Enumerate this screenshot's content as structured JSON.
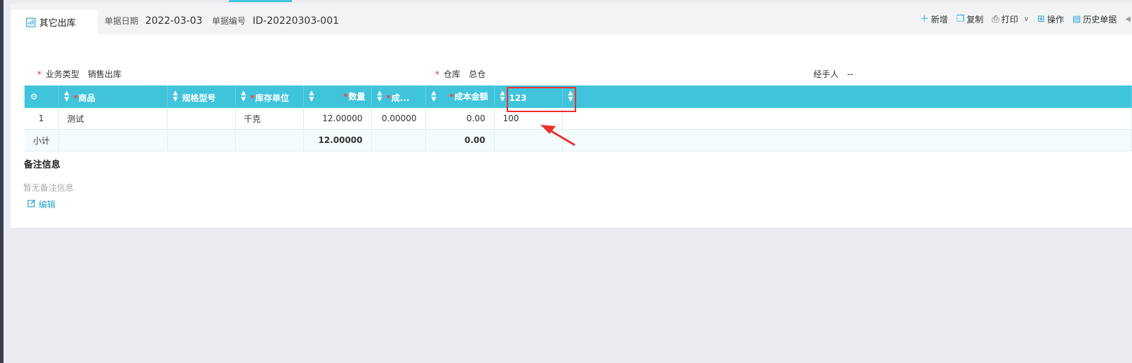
{
  "tab": {
    "label": "其它出库"
  },
  "doc": {
    "date_label": "单据日期",
    "date_value": "2022-03-03",
    "no_label": "单据编号",
    "no_value": "ID-20220303-001"
  },
  "toolbar": {
    "add": "新增",
    "copy": "复制",
    "print": "打印",
    "ops": "操作",
    "history": "历史单据"
  },
  "form": {
    "biz_type_label": "业务类型",
    "biz_type_value": "销售出库",
    "warehouse_label": "仓库",
    "warehouse_value": "总仓",
    "handler_label": "经手人",
    "handler_value": "--"
  },
  "grid": {
    "headers": {
      "product": "商品",
      "spec": "规格型号",
      "unit": "库存单位",
      "qty": "数量",
      "cost": "成...",
      "cost_amount": "成本金额",
      "custom": "123"
    },
    "rows": [
      {
        "index": "1",
        "product": "测试",
        "spec": "",
        "unit": "千克",
        "qty": "12.00000",
        "cost": "0.00000",
        "cost_amount": "0.00",
        "custom": "100"
      }
    ],
    "subtotal": {
      "label": "小计",
      "qty": "12.00000",
      "cost_amount": "0.00"
    }
  },
  "remarks": {
    "title": "备注信息",
    "empty": "暂无备注信息",
    "edit": "编辑"
  },
  "colors": {
    "accent": "#40c4dc",
    "highlight": "#e8322f",
    "link": "#2aa5c9"
  }
}
